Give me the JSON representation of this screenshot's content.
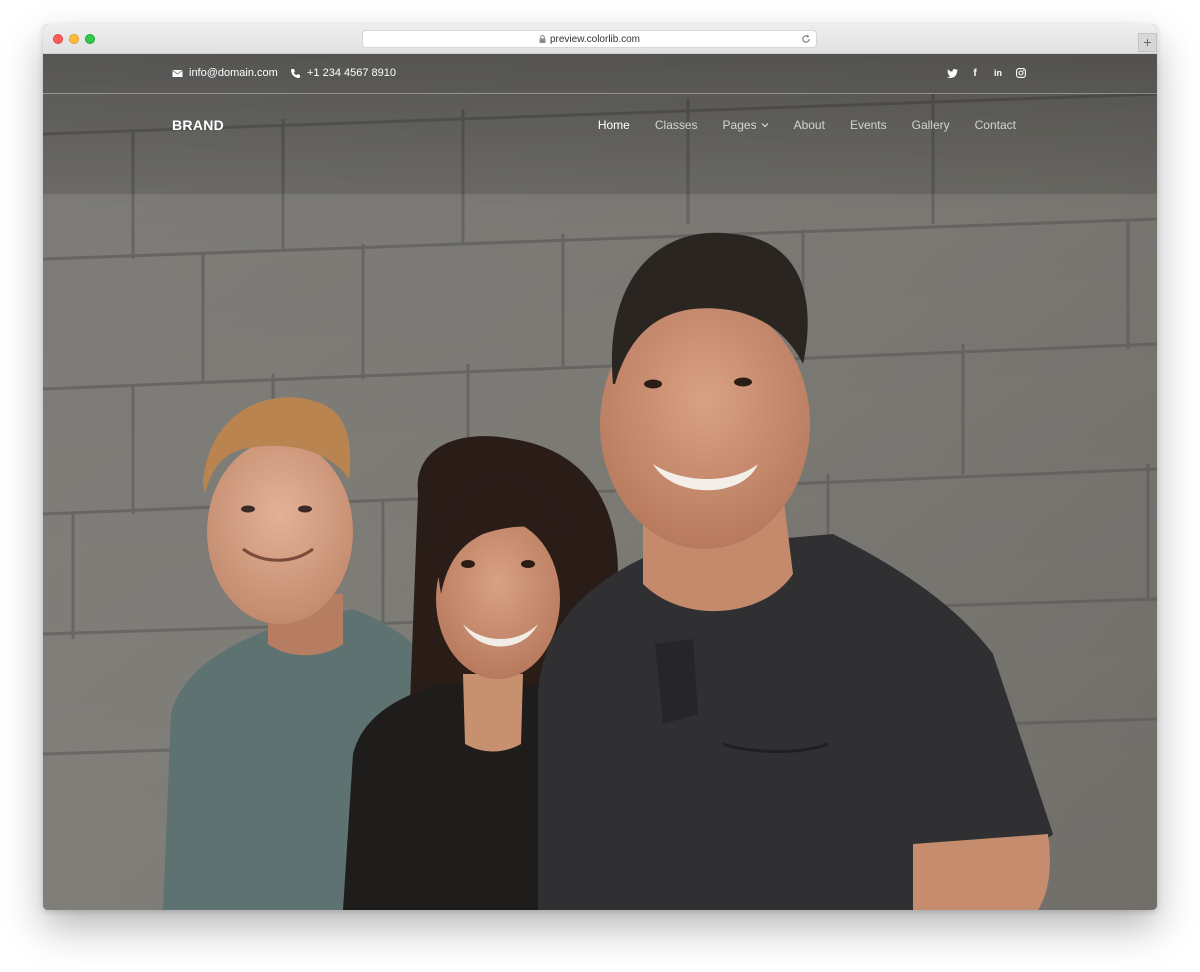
{
  "browser": {
    "url": "preview.colorlib.com",
    "new_tab_label": "+"
  },
  "topbar": {
    "email": "info@domain.com",
    "phone": "+1 234 4567 8910",
    "social": [
      {
        "icon": "twitter-icon",
        "glyph": ""
      },
      {
        "icon": "facebook-icon",
        "glyph": "f"
      },
      {
        "icon": "linkedin-icon",
        "glyph": "in"
      },
      {
        "icon": "instagram-icon",
        "glyph": ""
      }
    ]
  },
  "header": {
    "brand": "BRAND",
    "nav": [
      {
        "label": "Home",
        "active": true
      },
      {
        "label": "Classes"
      },
      {
        "label": "Pages",
        "dropdown": true
      },
      {
        "label": "About"
      },
      {
        "label": "Events"
      },
      {
        "label": "Gallery"
      },
      {
        "label": "Contact"
      }
    ]
  },
  "hero": {
    "image_subject": "three smiling people standing in front of a grey cinder block wall"
  }
}
